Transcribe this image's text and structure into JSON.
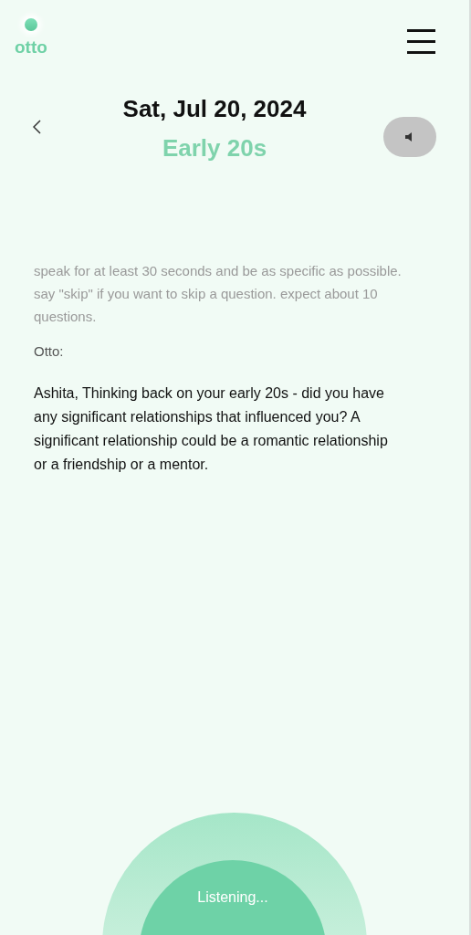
{
  "header": {
    "logo_text": "otto"
  },
  "title": {
    "date": "Sat, Jul 20, 2024",
    "subtitle": "Early 20s"
  },
  "instructions": "speak for at least 30 seconds and be as specific as possible. say \"skip\" if you want to skip a question. expect about 10 questions.",
  "speaker": "Otto:",
  "question": "Ashita, Thinking back on your early 20s - did you have any significant relationships that influenced you? A significant relationship could be a romantic relationship or a friendship or a mentor.",
  "listen_button": {
    "label": "Listening..."
  }
}
